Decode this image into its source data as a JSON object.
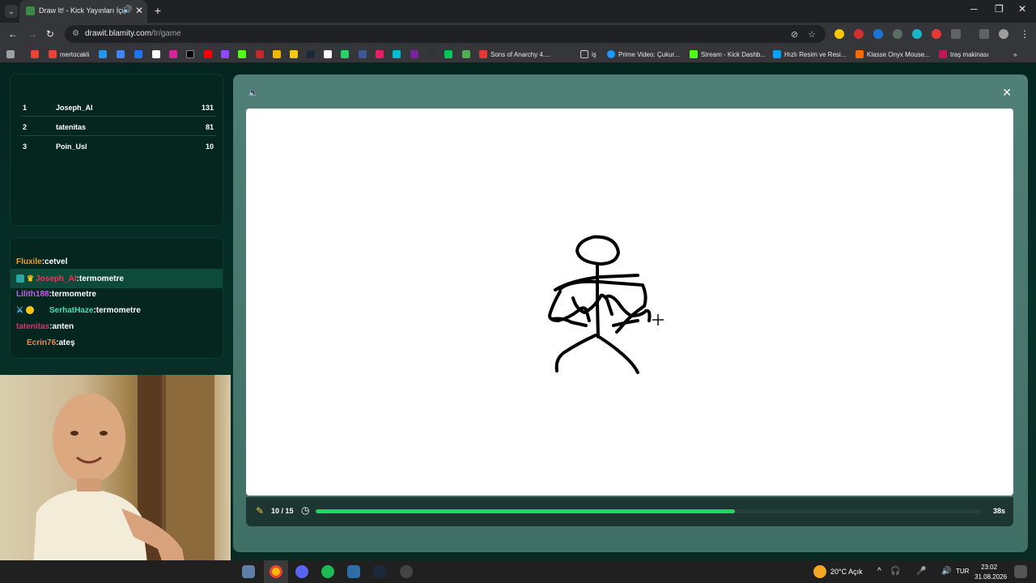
{
  "browser": {
    "tab_title": "Draw It! - Kick Yayınları İçin",
    "url_host": "drawit.blamity.com",
    "url_path": "/tr/game",
    "bookmarks": [
      {
        "label": "mertocakli",
        "color": "#ea4335"
      },
      {
        "label": "Sons of Anarchy 4....",
        "color": "#e53935"
      },
      {
        "label": "iş",
        "color": "#9aa0a6"
      },
      {
        "label": "Prime Video: Çukur...",
        "color": "#1a98ff"
      },
      {
        "label": "Stream - Kick Dashb...",
        "color": "#53fc18"
      },
      {
        "label": "Hızlı Resim ve Resi...",
        "color": "#00a2ff"
      },
      {
        "label": "Klasse Onyx Mouse...",
        "color": "#ff6a00"
      },
      {
        "label": "traş makinası",
        "color": "#c2185b"
      }
    ]
  },
  "leaderboard": [
    {
      "rank": "1",
      "name": "Joseph_AI",
      "score": "131"
    },
    {
      "rank": "2",
      "name": "tatenitas",
      "score": "81"
    },
    {
      "rank": "3",
      "name": "Poin_Usl",
      "score": "10"
    }
  ],
  "chat": [
    {
      "user": "Fluxile",
      "sep": ":",
      "msg": "cetvel",
      "color": "#f0a030"
    },
    {
      "user": "Joseph_AI",
      "sep": ":",
      "msg": "termometre",
      "color": "#e23a5a"
    },
    {
      "user": "Lilith188",
      "sep": ":",
      "msg": "termometre",
      "color": "#c85af0"
    },
    {
      "user": "SerhatHaze",
      "sep": ":",
      "msg": "termometre",
      "color": "#40e0b0"
    },
    {
      "user": "tatenitas",
      "sep": ":",
      "msg": "anten",
      "color": "#e0306a"
    },
    {
      "user": "Ecrin76",
      "sep": ":",
      "msg": "ateş",
      "color": "#f08a4a"
    }
  ],
  "game": {
    "round": "10 / 15",
    "timer_text": "38s",
    "progress": 0.63
  },
  "taskbar": {
    "weather": "20°C  Açık",
    "lang": "TUR",
    "time": "23:02",
    "date": "31.08.2026"
  }
}
